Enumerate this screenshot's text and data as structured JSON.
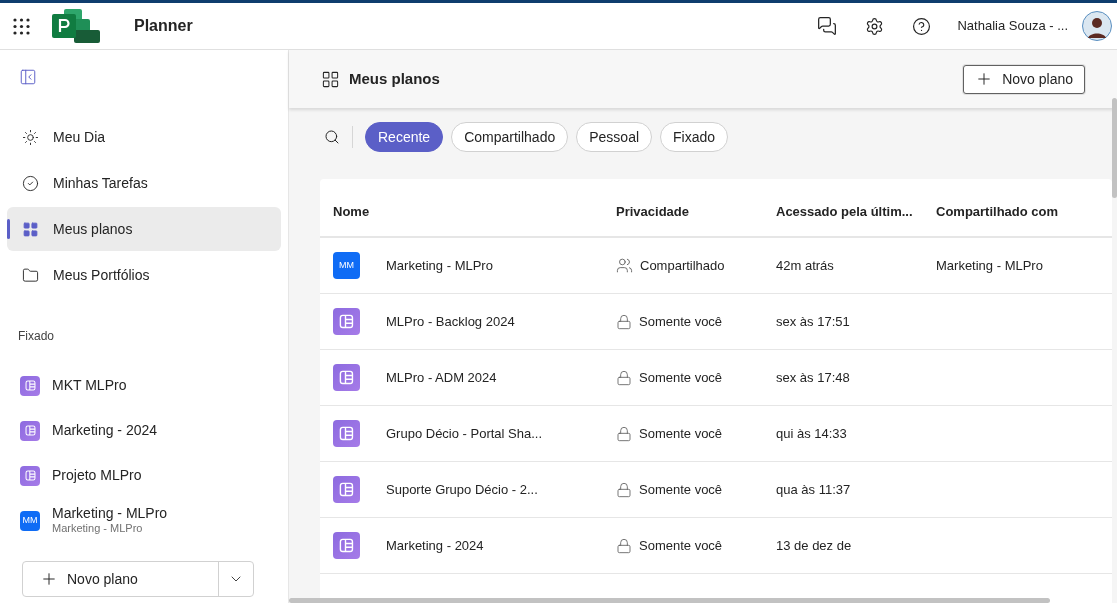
{
  "app": {
    "title": "Planner",
    "user": "Nathalia Souza - ..."
  },
  "sidebar": {
    "nav": [
      {
        "label": "Meu Dia",
        "kind": "day",
        "selected": false
      },
      {
        "label": "Minhas Tarefas",
        "kind": "tasks",
        "selected": false
      },
      {
        "label": "Meus planos",
        "kind": "plans",
        "selected": true
      },
      {
        "label": "Meus Portfólios",
        "kind": "portfolios",
        "selected": false
      }
    ],
    "pinned_heading": "Fixado",
    "pinned": [
      {
        "label": "MKT MLPro",
        "kind": "plan"
      },
      {
        "label": "Marketing - 2024",
        "kind": "plan"
      },
      {
        "label": "Projeto MLPro",
        "kind": "plan"
      },
      {
        "label": "Marketing - MLPro",
        "subtitle": "Marketing - MLPro",
        "kind": "group",
        "initials": "MM"
      }
    ],
    "new_plan": "Novo plano"
  },
  "main": {
    "title": "Meus planos",
    "new_plan": "Novo plano",
    "filters": [
      {
        "label": "Recente",
        "selected": true
      },
      {
        "label": "Compartilhado",
        "selected": false
      },
      {
        "label": "Pessoal",
        "selected": false
      },
      {
        "label": "Fixado",
        "selected": false
      }
    ],
    "table": {
      "columns": [
        "Nome",
        "Privacidade",
        "Acessado pela últim...",
        "Compartilhado com"
      ],
      "rows": [
        {
          "name": "Marketing - MLPro",
          "kind": "group",
          "initials": "MM",
          "privacy": {
            "label": "Compartilhado",
            "kind": "shared"
          },
          "accessed": "42m atrás",
          "shared_with": "Marketing - MLPro"
        },
        {
          "name": "MLPro - Backlog 2024",
          "kind": "plan",
          "privacy": {
            "label": "Somente você",
            "kind": "private"
          },
          "accessed": "sex às 17:51"
        },
        {
          "name": "MLPro - ADM 2024",
          "kind": "plan",
          "privacy": {
            "label": "Somente você",
            "kind": "private"
          },
          "accessed": "sex às 17:48"
        },
        {
          "name": "Grupo Décio - Portal Sha...",
          "kind": "plan",
          "privacy": {
            "label": "Somente você",
            "kind": "private"
          },
          "accessed": "qui às 14:33"
        },
        {
          "name": "Suporte Grupo Décio - 2...",
          "kind": "plan",
          "privacy": {
            "label": "Somente você",
            "kind": "private"
          },
          "accessed": "qua às 11:37"
        },
        {
          "name": "Marketing - 2024",
          "kind": "plan",
          "privacy": {
            "label": "Somente você",
            "kind": "private"
          },
          "accessed": "13 de dez de"
        }
      ]
    }
  }
}
